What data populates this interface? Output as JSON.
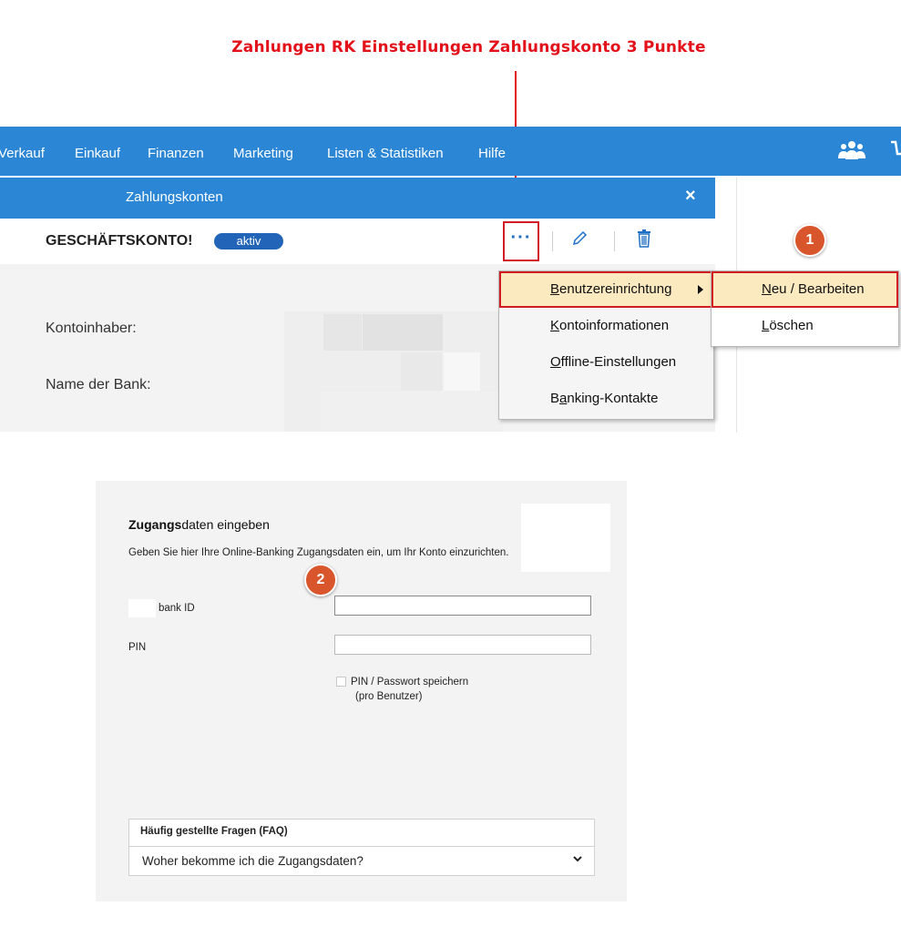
{
  "annotation": {
    "title": "Zahlungen RK Einstellungen Zahlungskonto 3 Punkte",
    "color": "#e3111a",
    "step1": "1",
    "step2": "2",
    "step_badge_color": "#d9552b"
  },
  "topnav": {
    "color": "#2b86d6",
    "items": [
      "Verkauf",
      "Einkauf",
      "Finanzen",
      "Marketing",
      "Listen & Statistiken",
      "Hilfe"
    ],
    "icons": [
      "people-icon",
      "cart-icon"
    ]
  },
  "dialog": {
    "title": "Zahlungskonten",
    "close_label": "×",
    "account_name": "GESCHÄFTSKONTO!",
    "status_badge": "aktiv",
    "more_label": "···",
    "fields": {
      "owner_label": "Kontoinhaber:",
      "bank_label": "Name der Bank:"
    }
  },
  "context_menu": {
    "items": [
      {
        "label": "Benutzereinrichtung",
        "accel": "B",
        "has_submenu": true,
        "active": true
      },
      {
        "label": "Kontoinformationen",
        "accel": "K"
      },
      {
        "label": "Offline-Einstellungen",
        "accel": "O"
      },
      {
        "label": "Banking-Kontakte",
        "accel": "a"
      }
    ],
    "submenu": [
      {
        "label": "Neu / Bearbeiten",
        "accel": "N",
        "active": true
      },
      {
        "label": "Löschen",
        "accel": "L"
      }
    ]
  },
  "login": {
    "header_bold": "Zugangs",
    "header_rest": "daten eingeben",
    "description": "Geben Sie hier Ihre Online-Banking Zugangsdaten ein, um Ihr Konto einzurichten.",
    "bank_id_label": "bank ID",
    "bank_id_value": "",
    "pin_label": "PIN",
    "pin_value": "",
    "save_pin_label": "PIN / Passwort speichern",
    "save_pin_sub": "(pro Benutzer)",
    "save_pin_checked": false
  },
  "faq": {
    "title": "Häufig gestellte Fragen (FAQ)",
    "question": "Woher bekomme ich die Zugangsdaten?"
  }
}
